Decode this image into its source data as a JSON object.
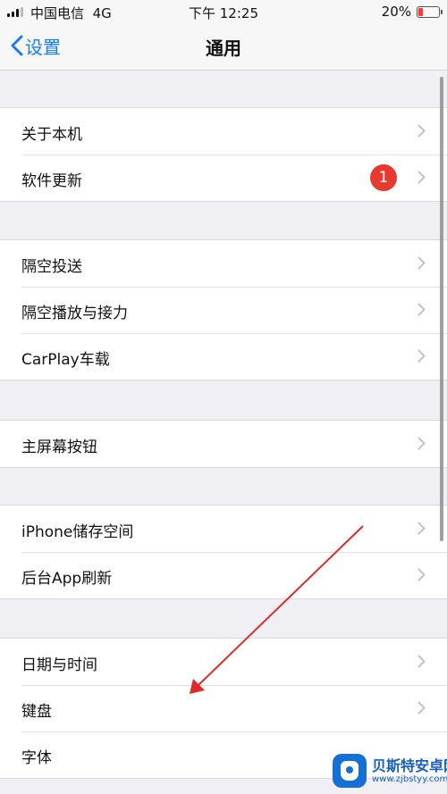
{
  "status_bar": {
    "carrier": "中国电信",
    "network": "4G",
    "time": "下午 12:25",
    "battery_percent": "20%",
    "battery_level": 0.2
  },
  "nav": {
    "back_label": "设置",
    "title": "通用"
  },
  "groups": [
    {
      "items": [
        {
          "label": "关于本机"
        },
        {
          "label": "软件更新",
          "badge": "1"
        }
      ]
    },
    {
      "items": [
        {
          "label": "隔空投送"
        },
        {
          "label": "隔空播放与接力"
        },
        {
          "label": "CarPlay车载"
        }
      ]
    },
    {
      "items": [
        {
          "label": "主屏幕按钮"
        }
      ]
    },
    {
      "items": [
        {
          "label": "iPhone储存空间"
        },
        {
          "label": "后台App刷新"
        }
      ]
    },
    {
      "items": [
        {
          "label": "日期与时间"
        },
        {
          "label": "键盘"
        },
        {
          "label": "字体"
        }
      ]
    }
  ],
  "watermark": {
    "name": "贝斯特安卓网",
    "url": "www.zjbstyy.com"
  },
  "colors": {
    "accent": "#1a7cf5",
    "badge": "#e8392e",
    "annotation_arrow": "#e02b2b",
    "background": "#efeff4"
  }
}
